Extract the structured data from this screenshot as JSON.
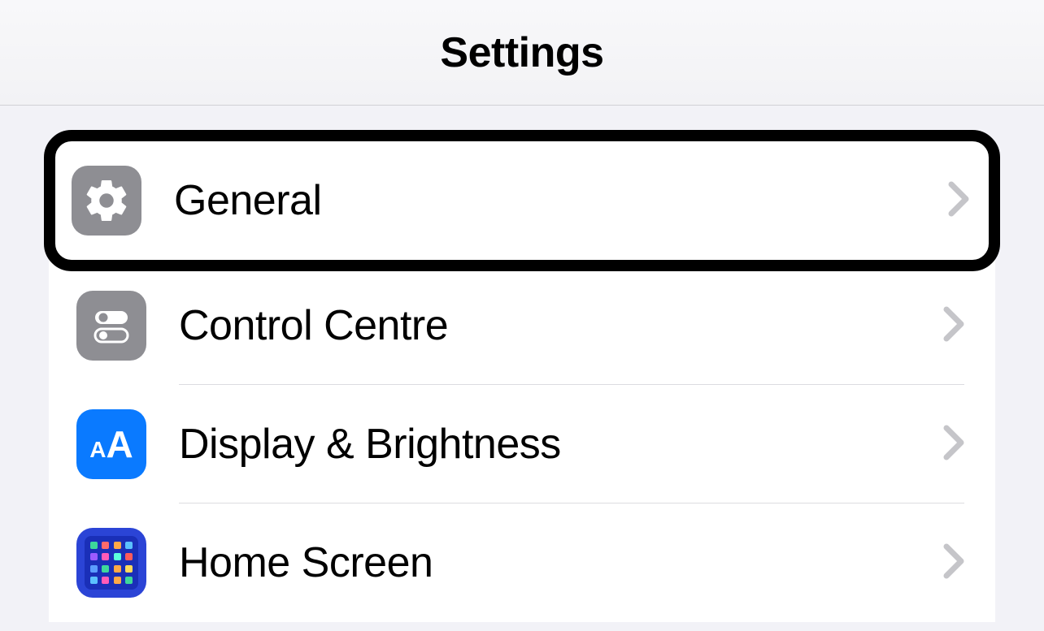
{
  "header": {
    "title": "Settings"
  },
  "rows": [
    {
      "label": "General",
      "icon": "gear-icon",
      "highlighted": true
    },
    {
      "label": "Control Centre",
      "icon": "control-centre-icon",
      "highlighted": false
    },
    {
      "label": "Display & Brightness",
      "icon": "display-brightness-icon",
      "highlighted": false
    },
    {
      "label": "Home Screen",
      "icon": "home-screen-icon",
      "highlighted": false
    }
  ]
}
